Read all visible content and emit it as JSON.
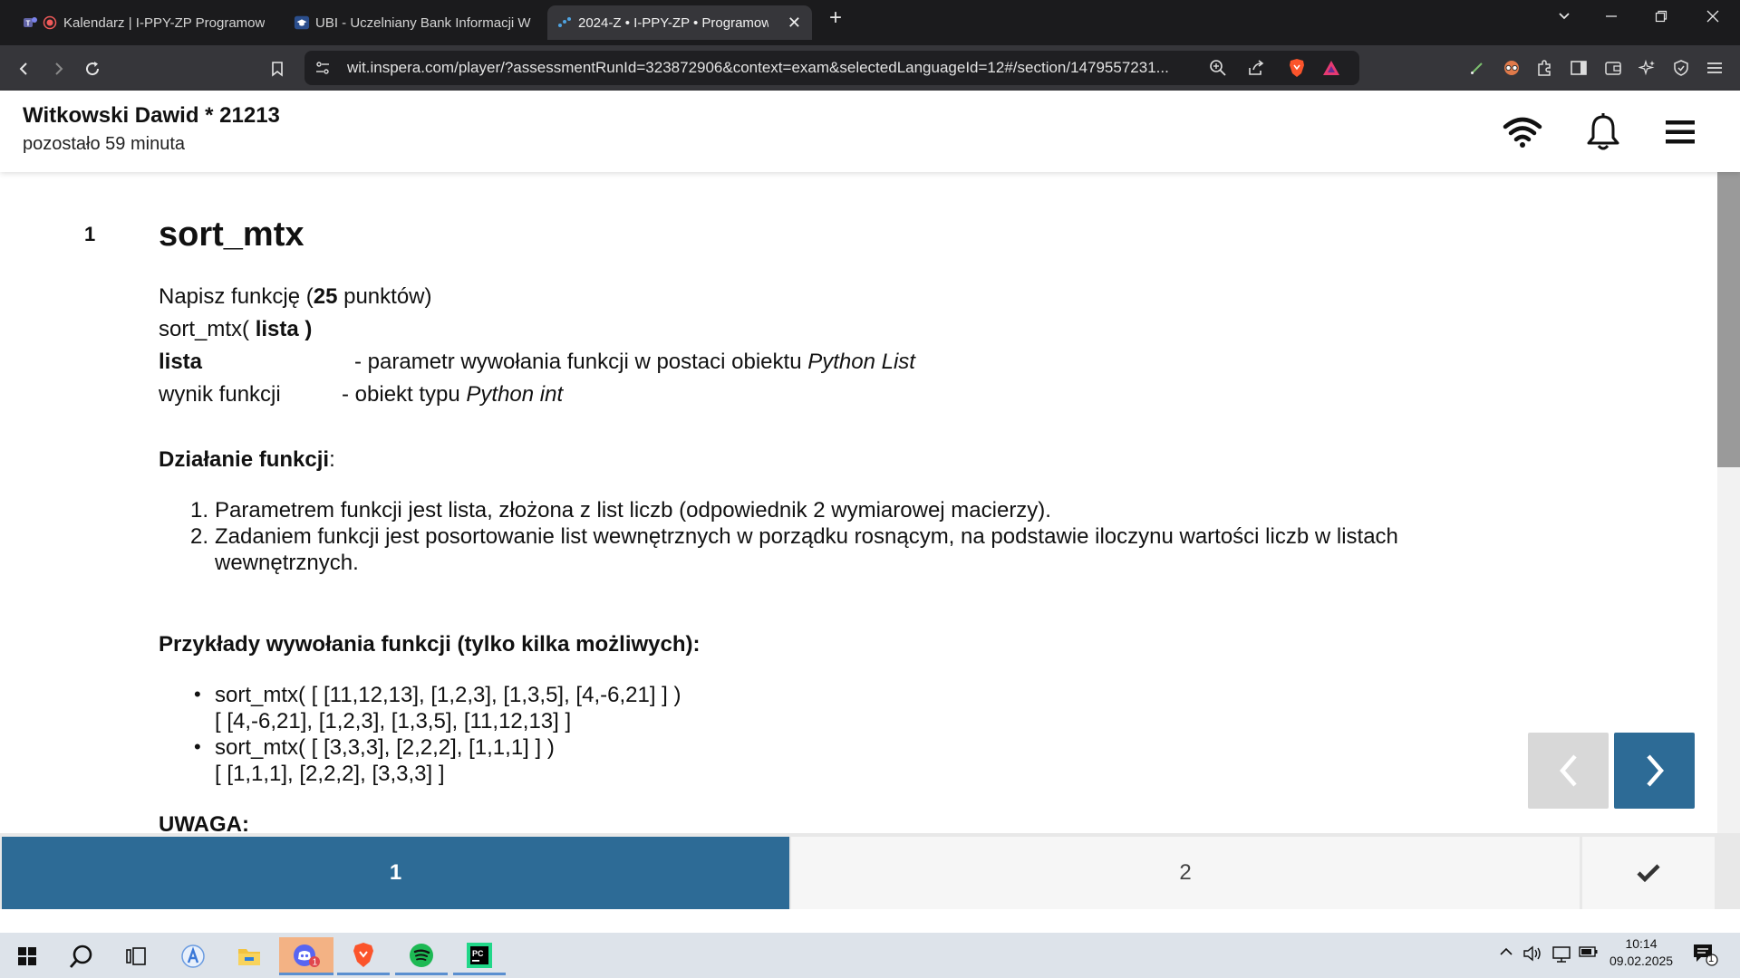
{
  "browser": {
    "tabs": [
      {
        "title": "Kalendarz | I-PPY-ZP Programow",
        "icon": "teams-icon"
      },
      {
        "title": "UBI - Uczelniany Bank Informacji W",
        "icon": "ubi-cap-icon"
      },
      {
        "title": "2024-Z • I-PPY-ZP • Programow",
        "icon": "inspera-icon"
      }
    ],
    "url": "wit.inspera.com/player/?assessmentRunId=323872906&context=exam&selectedLanguageId=12#/section/1479557231..."
  },
  "header": {
    "student_name": "Witkowski Dawid * 21213",
    "time_left": "pozostało 59 minuta"
  },
  "question": {
    "number": "1",
    "title": "sort_mtx",
    "line1_pre": "Napisz funkcję (",
    "line1_points": "25",
    "line1_post": " punktów)",
    "sig_pre": "sort_mtx( ",
    "sig_param": "lista )",
    "param_name": "lista",
    "param_desc": "- parametr wywołania funkcji w postaci obiektu ",
    "param_type": "Python List",
    "result_label": "wynik funkcji",
    "result_desc": "- obiekt typu ",
    "result_type": "Python int",
    "section_action": "Działanie funkcji",
    "section_action_colon": ":",
    "steps": [
      "Parametrem funkcji jest lista, złożona z list liczb (odpowiednik 2 wymiarowej macierzy).",
      "Zadaniem funkcji jest posortowanie list wewnętrznych w porządku rosnącym, na podstawie iloczynu wartości liczb w listach",
      "wewnętrznych."
    ],
    "section_examples": "Przykłady wywołania funkcji (tylko kilka możliwych):",
    "examples": [
      {
        "call": "sort_mtx( [ [11,12,13], [1,2,3], [1,3,5], [4,-6,21] ] )",
        "result": "[ [4,-6,21], [1,2,3], [1,3,5], [11,12,13] ]"
      },
      {
        "call": "sort_mtx( [ [3,3,3], [2,2,2], [1,1,1] ] )",
        "result": "[ [1,1,1], [2,2,2], [3,3,3] ]"
      }
    ],
    "note_label": "UWAGA:"
  },
  "question_nav": {
    "items": [
      "1",
      "2"
    ],
    "current": "1"
  },
  "taskbar": {
    "time": "10:14",
    "date": "09.02.2025",
    "notifications": "1"
  },
  "colors": {
    "accent": "#2d6b96",
    "nav_disabled": "#d8d8d8"
  }
}
